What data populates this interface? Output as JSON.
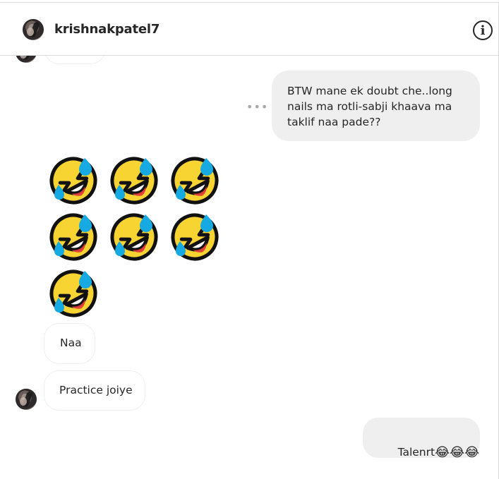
{
  "header": {
    "username": "krishnakpatel7",
    "info_icon": "info-icon"
  },
  "messages": [
    {
      "direction": "outgoing",
      "text": "BTW mane ek doubt che..long nails ma rotli-sabji khaava ma taklif naa pade??",
      "more_icon": "more-options-icon"
    },
    {
      "direction": "incoming",
      "emoji_icon": "rolling-on-floor-laughing-icon",
      "emoji_count": 7
    },
    {
      "direction": "incoming",
      "text": "Naa"
    },
    {
      "direction": "incoming",
      "text": "Practice joiye"
    },
    {
      "direction": "outgoing",
      "text": "Talenrt",
      "suffix_emojis": "😂😂😂"
    }
  ],
  "colors": {
    "outgoing_bubble": "#efefef",
    "incoming_border": "#efefef",
    "text": "#262626",
    "emoji_yellow": "#f7d432",
    "emoji_outline": "#111111",
    "tear_blue": "#16a9e2",
    "mouth_red": "#e43c3c"
  }
}
